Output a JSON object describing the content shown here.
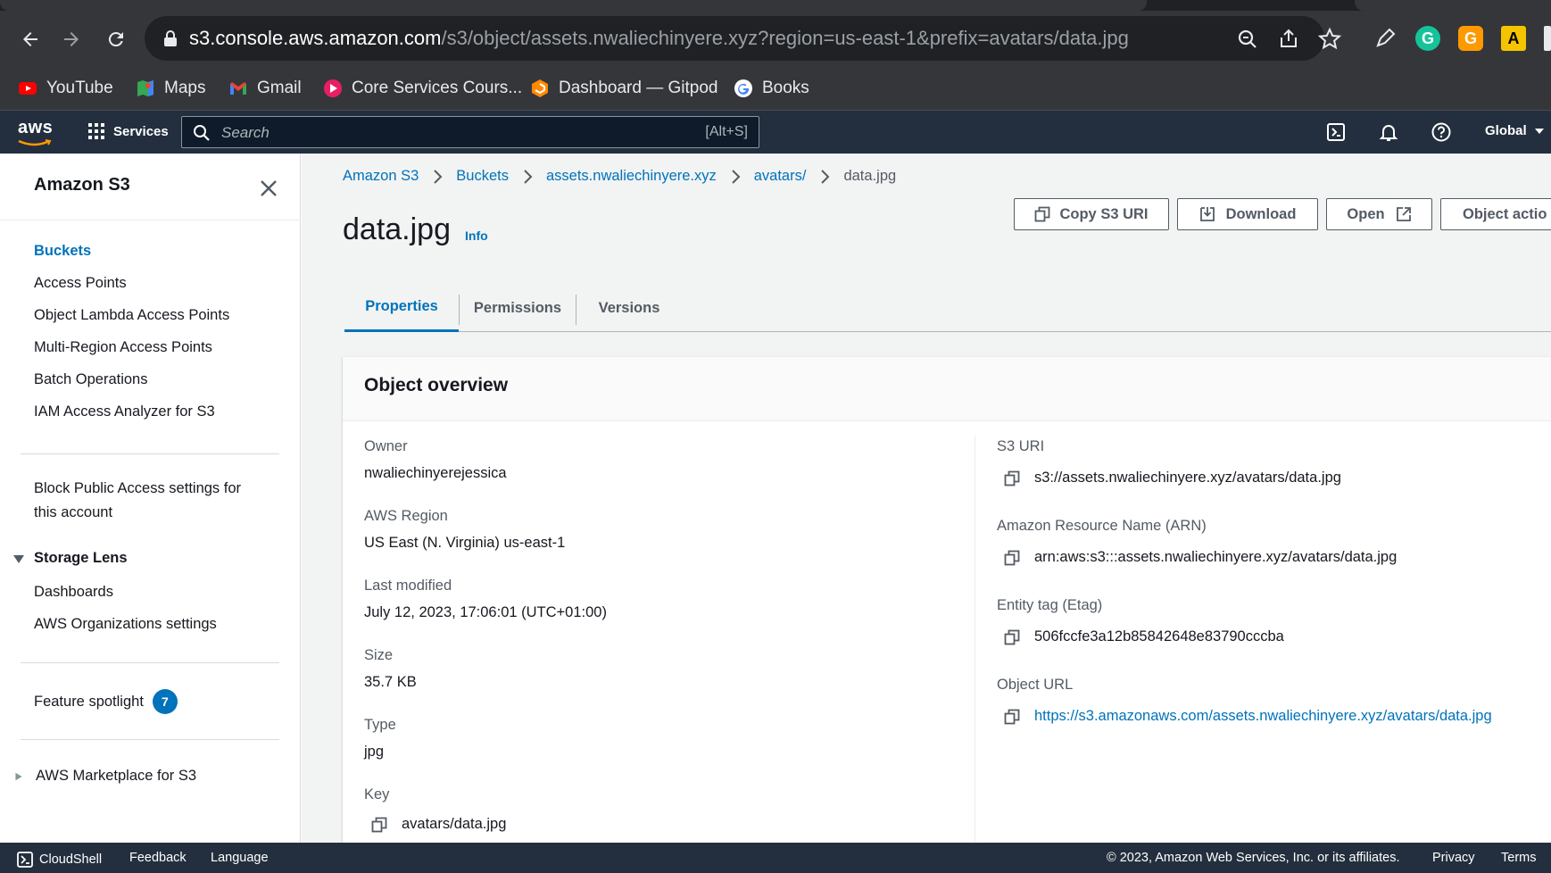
{
  "browser": {
    "url_host": "s3.console.aws.amazon.com",
    "url_path": "/s3/object/assets.nwaliechinyere.xyz?region=us-east-1&prefix=avatars/data.jpg",
    "bookmarks": [
      "YouTube",
      "Maps",
      "Gmail",
      "Core Services Cours...",
      "Dashboard — Gitpod",
      "Books"
    ]
  },
  "aws_header": {
    "logo": "aws",
    "services_label": "Services",
    "search_placeholder": "Search",
    "search_shortcut": "[Alt+S]",
    "region_label": "Global"
  },
  "sidebar": {
    "title": "Amazon S3",
    "items": [
      "Buckets",
      "Access Points",
      "Object Lambda Access Points",
      "Multi-Region Access Points",
      "Batch Operations",
      "IAM Access Analyzer for S3"
    ],
    "block_public_access_line1": "Block Public Access settings for",
    "block_public_access_line2": "this account",
    "storage_lens": {
      "label": "Storage Lens",
      "items": [
        "Dashboards",
        "AWS Organizations settings"
      ]
    },
    "feature_spotlight": "Feature spotlight",
    "feature_spotlight_count": "7",
    "marketplace": "AWS Marketplace for S3"
  },
  "breadcrumb": [
    "Amazon S3",
    "Buckets",
    "assets.nwaliechinyere.xyz",
    "avatars/",
    "data.jpg"
  ],
  "page": {
    "title": "data.jpg",
    "info": "Info",
    "actions": {
      "copy_uri": "Copy S3 URI",
      "download": "Download",
      "open": "Open",
      "object_actions": "Object actio"
    },
    "tabs": [
      "Properties",
      "Permissions",
      "Versions"
    ]
  },
  "overview": {
    "title": "Object overview",
    "left": [
      {
        "label": "Owner",
        "value": "nwaliechinyerejessica"
      },
      {
        "label": "AWS Region",
        "value": "US East (N. Virginia) us-east-1"
      },
      {
        "label": "Last modified",
        "value": "July 12, 2023, 17:06:01 (UTC+01:00)"
      },
      {
        "label": "Size",
        "value": "35.7 KB"
      },
      {
        "label": "Type",
        "value": "jpg"
      },
      {
        "label": "Key",
        "value": "avatars/data.jpg"
      }
    ],
    "right": [
      {
        "label": "S3 URI",
        "value": "s3://assets.nwaliechinyere.xyz/avatars/data.jpg"
      },
      {
        "label": "Amazon Resource Name (ARN)",
        "value": "arn:aws:s3:::assets.nwaliechinyere.xyz/avatars/data.jpg"
      },
      {
        "label": "Entity tag (Etag)",
        "value": "506fccfe3a12b85842648e83790cccba"
      },
      {
        "label": "Object URL",
        "value": "https://s3.amazonaws.com/assets.nwaliechinyere.xyz/avatars/data.jpg"
      }
    ]
  },
  "footer": {
    "cloudshell": "CloudShell",
    "feedback": "Feedback",
    "language": "Language",
    "copyright": "© 2023, Amazon Web Services, Inc. or its affiliates.",
    "privacy": "Privacy",
    "terms": "Terms"
  },
  "colors": {
    "aws_nav": "#232f3e",
    "link_blue": "#0073bb",
    "browser_chrome": "#35363a"
  }
}
